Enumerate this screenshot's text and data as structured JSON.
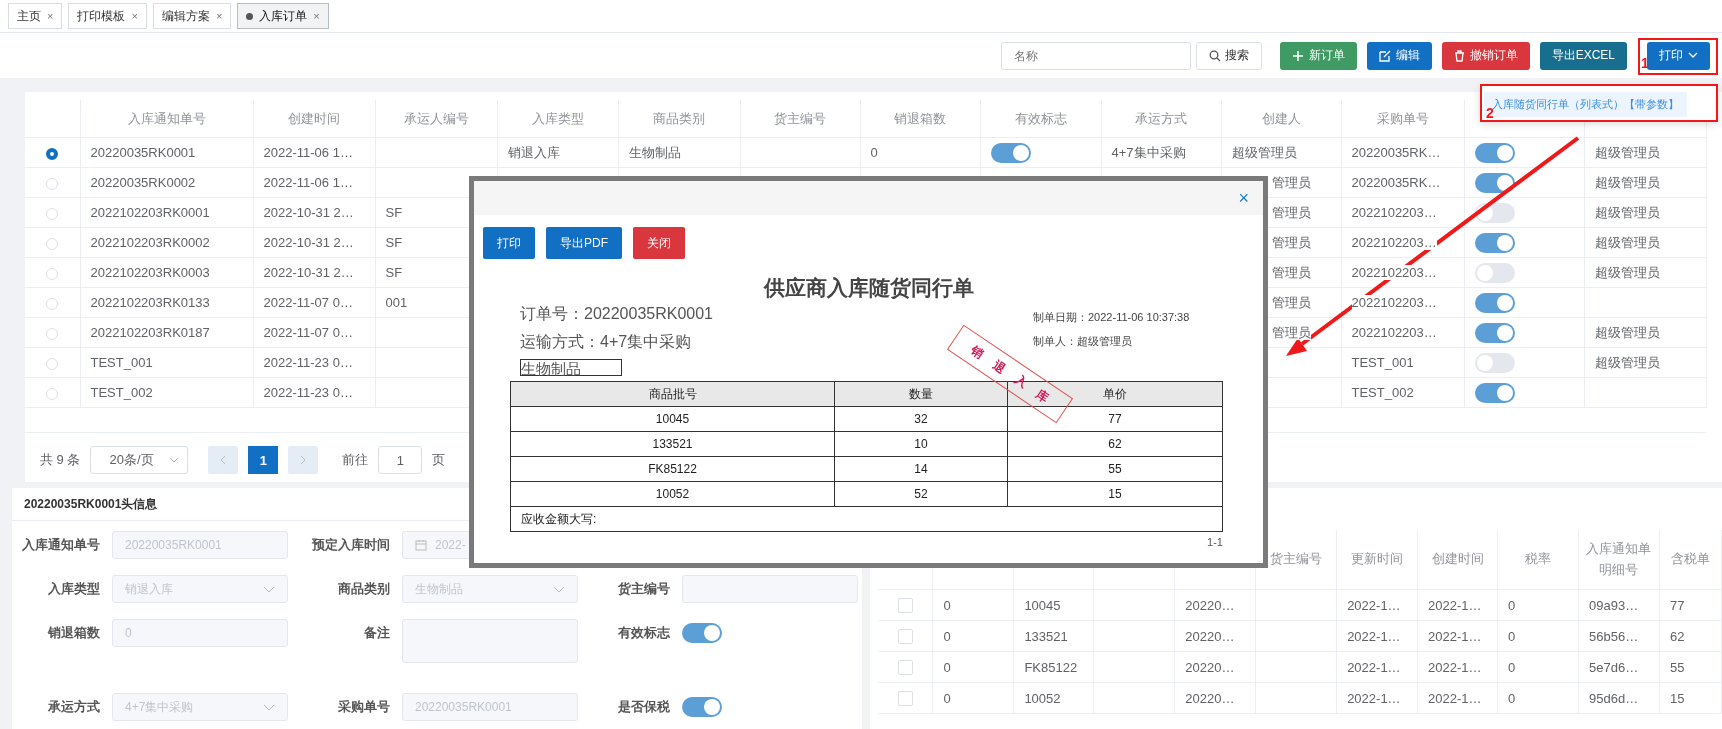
{
  "tabs": [
    {
      "label": "主页",
      "close": "×",
      "selected": false
    },
    {
      "label": "打印模板",
      "close": "×",
      "selected": false
    },
    {
      "label": "编辑方案",
      "close": "×",
      "selected": false
    },
    {
      "label": "入库订单",
      "close": "×",
      "selected": true
    }
  ],
  "toolbar": {
    "search_placeholder": "名称",
    "search_button": "搜索",
    "buttons": [
      {
        "label": "新订单",
        "kind": "add"
      },
      {
        "label": "编辑",
        "kind": "edit"
      },
      {
        "label": "撤销订单",
        "kind": "delete"
      },
      {
        "label": "导出EXCEL",
        "kind": "export"
      },
      {
        "label": "打印",
        "kind": "print"
      }
    ]
  },
  "print_menu": {
    "item": "入库随货同行单（列表式）【带参数】"
  },
  "annotations": {
    "markers": [
      "1",
      "2"
    ]
  },
  "orders": {
    "columns": [
      "入库通知单号",
      "创建时间",
      "承运人编号",
      "入库类型",
      "商品类别",
      "货主编号",
      "销退箱数",
      "有效标志",
      "承运方式",
      "创建人",
      "采购单号"
    ],
    "rows": [
      {
        "selected": true,
        "covered": false,
        "notice_no": "20220035RK0001",
        "created": "2022-11-06 1…",
        "type": "销退入库",
        "category": "生物制品",
        "returns": "0",
        "valid": true,
        "shipping": "4+7集中采购",
        "creator": "超级管理员",
        "purchase_no": "20220035RK…",
        "column_12": true,
        "column_13": "超级管理员"
      },
      {
        "selected": false,
        "covered": true,
        "notice_no": "20220035RK0002",
        "created": "2022-11-06 1…",
        "creator": "管理员",
        "purchase_no": "20220035RK…",
        "column_12": true,
        "column_13": "超级管理员"
      },
      {
        "selected": false,
        "covered": true,
        "notice_no": "2022102203RK0001",
        "created": "2022-10-31 2…",
        "carrier": "SF",
        "creator": "管理员",
        "purchase_no": "2022102203…",
        "column_12": false,
        "column_13": "超级管理员"
      },
      {
        "selected": false,
        "covered": true,
        "notice_no": "2022102203RK0002",
        "created": "2022-10-31 2…",
        "carrier": "SF",
        "creator": "管理员",
        "purchase_no": "2022102203…",
        "column_12": true,
        "column_13": "超级管理员"
      },
      {
        "selected": false,
        "covered": true,
        "notice_no": "2022102203RK0003",
        "created": "2022-10-31 2…",
        "carrier": "SF",
        "creator": "管理员",
        "purchase_no": "2022102203…",
        "column_12": false,
        "column_13": "超级管理员"
      },
      {
        "selected": false,
        "covered": true,
        "notice_no": "2022102203RK0133",
        "created": "2022-11-07 0…",
        "carrier": "001",
        "creator": "管理员",
        "purchase_no": "2022102203…",
        "column_12": true
      },
      {
        "selected": false,
        "covered": true,
        "notice_no": "2022102203RK0187",
        "created": "2022-11-07 0…",
        "creator": "管理员",
        "purchase_no": "2022102203…",
        "column_12": true,
        "column_13": "超级管理员"
      },
      {
        "selected": false,
        "notice_no": "TEST_001",
        "created": "2022-11-23 0…",
        "purchase_no": "TEST_001",
        "column_12": false,
        "column_13": "超级管理员"
      },
      {
        "selected": false,
        "notice_no": "TEST_002",
        "created": "2022-11-23 0…",
        "purchase_no": "TEST_002",
        "column_12": true
      }
    ]
  },
  "pagination": {
    "total": "共 9 条",
    "page_size": "20条/页",
    "pages": [
      {
        "label": "1",
        "selected": true
      }
    ],
    "goto_label": "前往",
    "goto_value": "1",
    "page_unit": "页"
  },
  "header_form": {
    "title": "20220035RK0001头信息",
    "rows": [
      [
        {
          "label": "入库通知单号",
          "kind": "input",
          "value": "20220035RK0001"
        },
        {
          "label": "预定入库时间",
          "kind": "date",
          "value": "2022-"
        },
        null
      ],
      [
        {
          "label": "入库类型",
          "kind": "select",
          "value": "销退入库"
        },
        {
          "label": "商品类别",
          "kind": "select",
          "value": "生物制品"
        },
        {
          "label": "货主编号",
          "kind": "input"
        }
      ],
      [
        {
          "label": "销退箱数",
          "kind": "input",
          "value": "0"
        },
        {
          "label": "备注",
          "kind": "textarea"
        },
        {
          "label": "有效标志",
          "kind": "switch",
          "on": true
        }
      ],
      [
        {
          "label": "承运方式",
          "kind": "select",
          "value": "4+7集中采购"
        },
        {
          "label": "采购单号",
          "kind": "input",
          "value": "20220035RK0001"
        },
        {
          "label": "是否保税",
          "kind": "switch",
          "on": true
        }
      ]
    ]
  },
  "detail_table": {
    "columns": [
      null,
      null,
      null,
      null,
      "货主编号",
      "更新时间",
      "创建时间",
      "税率",
      "入库通知单明细号",
      "含税单"
    ],
    "rows": [
      {
        "checked": false,
        "cells": [
          "0",
          "10045",
          null,
          "20220…",
          null,
          "2022-1…",
          "2022-1…",
          "0",
          "09a93…",
          "77"
        ]
      },
      {
        "checked": false,
        "cells": [
          "0",
          "133521",
          null,
          "20220…",
          null,
          "2022-1…",
          "2022-1…",
          "0",
          "56b56…",
          "62"
        ]
      },
      {
        "checked": false,
        "cells": [
          "0",
          "FK85122",
          null,
          "20220…",
          null,
          "2022-1…",
          "2022-1…",
          "0",
          "5e7d6…",
          "55"
        ]
      },
      {
        "checked": false,
        "cells": [
          "0",
          "10052",
          null,
          "20220…",
          null,
          "2022-1…",
          "2022-1…",
          "0",
          "95d6d…",
          "15"
        ]
      }
    ]
  },
  "print_dialog": {
    "close": "×",
    "buttons": [
      {
        "label": "打印",
        "kind": "primary"
      },
      {
        "label": "导出PDF",
        "kind": "primary"
      },
      {
        "label": "关闭",
        "kind": "danger"
      }
    ],
    "doc": {
      "title": "供应商入库随货同行单",
      "order_no": "订单号：20220035RK0001",
      "shipping": "运输方式：4+7集中采购",
      "category": "生物制品",
      "date": "制单日期：2022-11-06 10:37:38",
      "maker": "制单人：超级管理员",
      "stamp": "销退入库",
      "columns": [
        "商品批号",
        "数量",
        "单价"
      ],
      "rows": [
        [
          "10045",
          "32",
          "77"
        ],
        [
          "133521",
          "10",
          "62"
        ],
        [
          "FK85122",
          "14",
          "55"
        ],
        [
          "10052",
          "52",
          "15"
        ]
      ],
      "footer": "应收金额大写:",
      "page": "1-1"
    }
  }
}
